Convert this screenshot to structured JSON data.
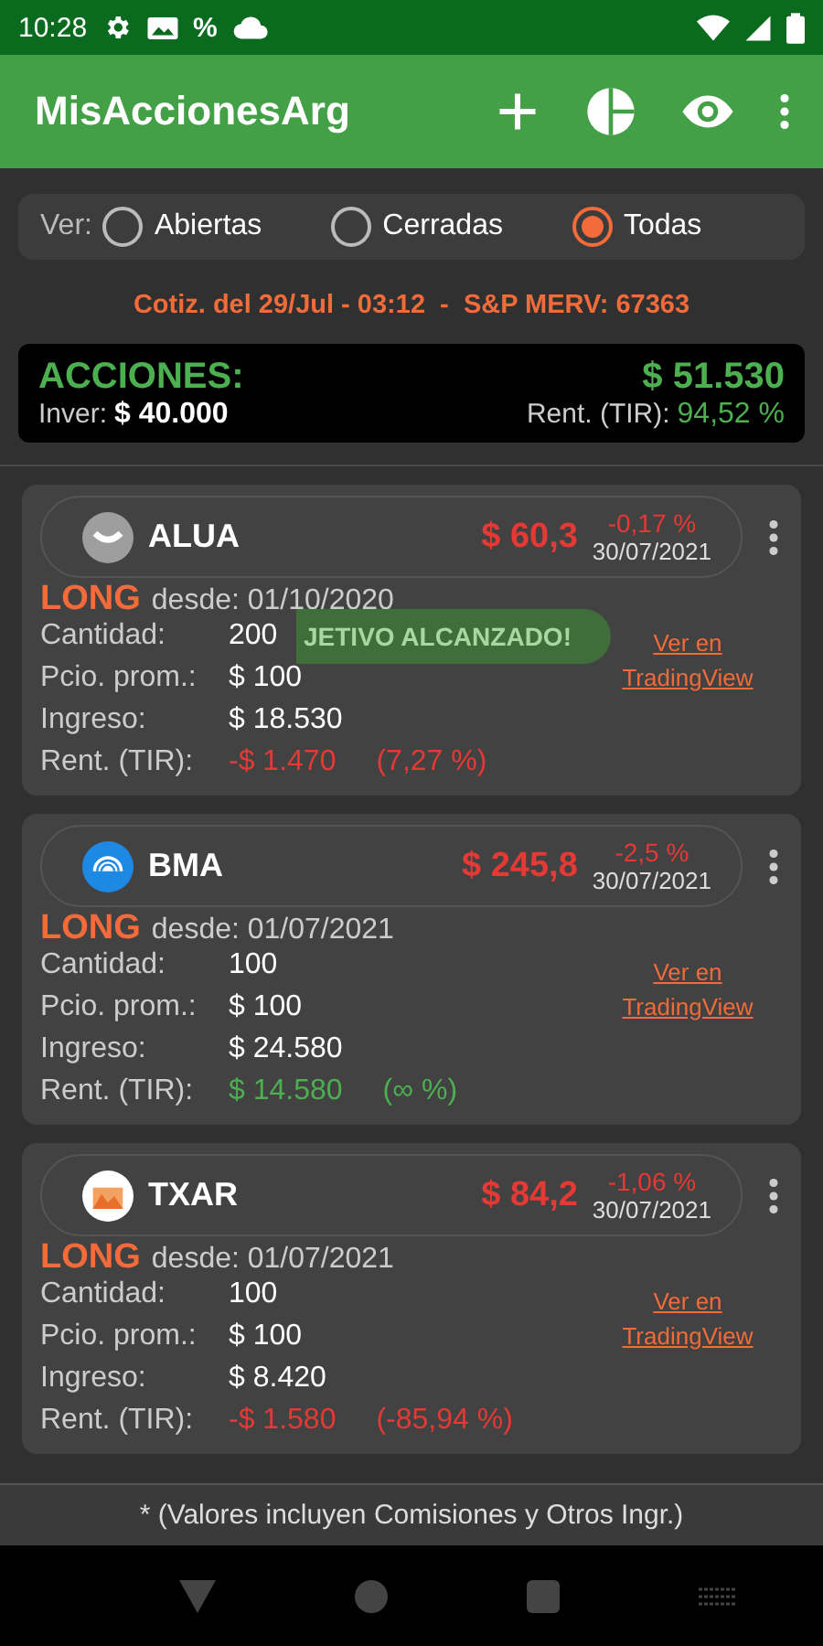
{
  "status_bar": {
    "time": "10:28",
    "percent": "%"
  },
  "app_bar": {
    "title": "MisAccionesArg"
  },
  "filter": {
    "label": "Ver:",
    "options": [
      {
        "label": "Abiertas",
        "selected": false
      },
      {
        "label": "Cerradas",
        "selected": false
      },
      {
        "label": "Todas",
        "selected": true
      }
    ]
  },
  "quote_line": "Cotiz. del 29/Jul - 03:12  -  S&P MERV: 67363",
  "summary": {
    "title": "ACCIONES:",
    "total": "$ 51.530",
    "invested_label": "Inver:",
    "invested": "$ 40.000",
    "return_label": "Rent. (TIR):",
    "return": "94,52 %"
  },
  "positions": [
    {
      "ticker": "ALUA",
      "kind": "chevron",
      "quote": {
        "price": "$ 60,3",
        "change": "-0,17 %",
        "date": "30/07/2021",
        "color": "#e53935"
      },
      "side": "LONG",
      "since": "desde: 01/10/2020",
      "rows": [
        {
          "label": "Cantidad:",
          "value": "200"
        },
        {
          "label": "Pcio. prom.:",
          "value": "$ 100"
        },
        {
          "label": "Ingreso:",
          "value": "$ 18.530"
        }
      ],
      "return_label": "Rent. (TIR):",
      "return": {
        "amount": "-$ 1.470",
        "pct": "(7,27 %)",
        "color": "#e53935"
      },
      "link": "Ver en TradingView",
      "toast": "JETIVO ALCANZADO!"
    },
    {
      "ticker": "BMA",
      "kind": "bank",
      "quote": {
        "price": "$ 245,8",
        "change": "-2,5 %",
        "date": "30/07/2021",
        "color": "#e53935"
      },
      "side": "LONG",
      "since": "desde: 01/07/2021",
      "rows": [
        {
          "label": "Cantidad:",
          "value": "100"
        },
        {
          "label": "Pcio. prom.:",
          "value": "$ 100"
        },
        {
          "label": "Ingreso:",
          "value": "$ 24.580"
        }
      ],
      "return_label": "Rent. (TIR):",
      "return": {
        "amount": "$ 14.580",
        "pct": "(∞ %)",
        "color": "#4caf50"
      },
      "link": "Ver en TradingView"
    },
    {
      "ticker": "TXAR",
      "kind": "mountain",
      "quote": {
        "price": "$ 84,2",
        "change": "-1,06 %",
        "date": "30/07/2021",
        "color": "#e53935"
      },
      "side": "LONG",
      "since": "desde: 01/07/2021",
      "rows": [
        {
          "label": "Cantidad:",
          "value": "100"
        },
        {
          "label": "Pcio. prom.:",
          "value": "$ 100"
        },
        {
          "label": "Ingreso:",
          "value": "$ 8.420"
        }
      ],
      "return_label": "Rent. (TIR):",
      "return": {
        "amount": "-$ 1.580",
        "pct": "(-85,94 %)",
        "color": "#e53935"
      },
      "link": "Ver en TradingView"
    }
  ],
  "footer_note": "* (Valores incluyen Comisiones y Otros Ingr.)"
}
